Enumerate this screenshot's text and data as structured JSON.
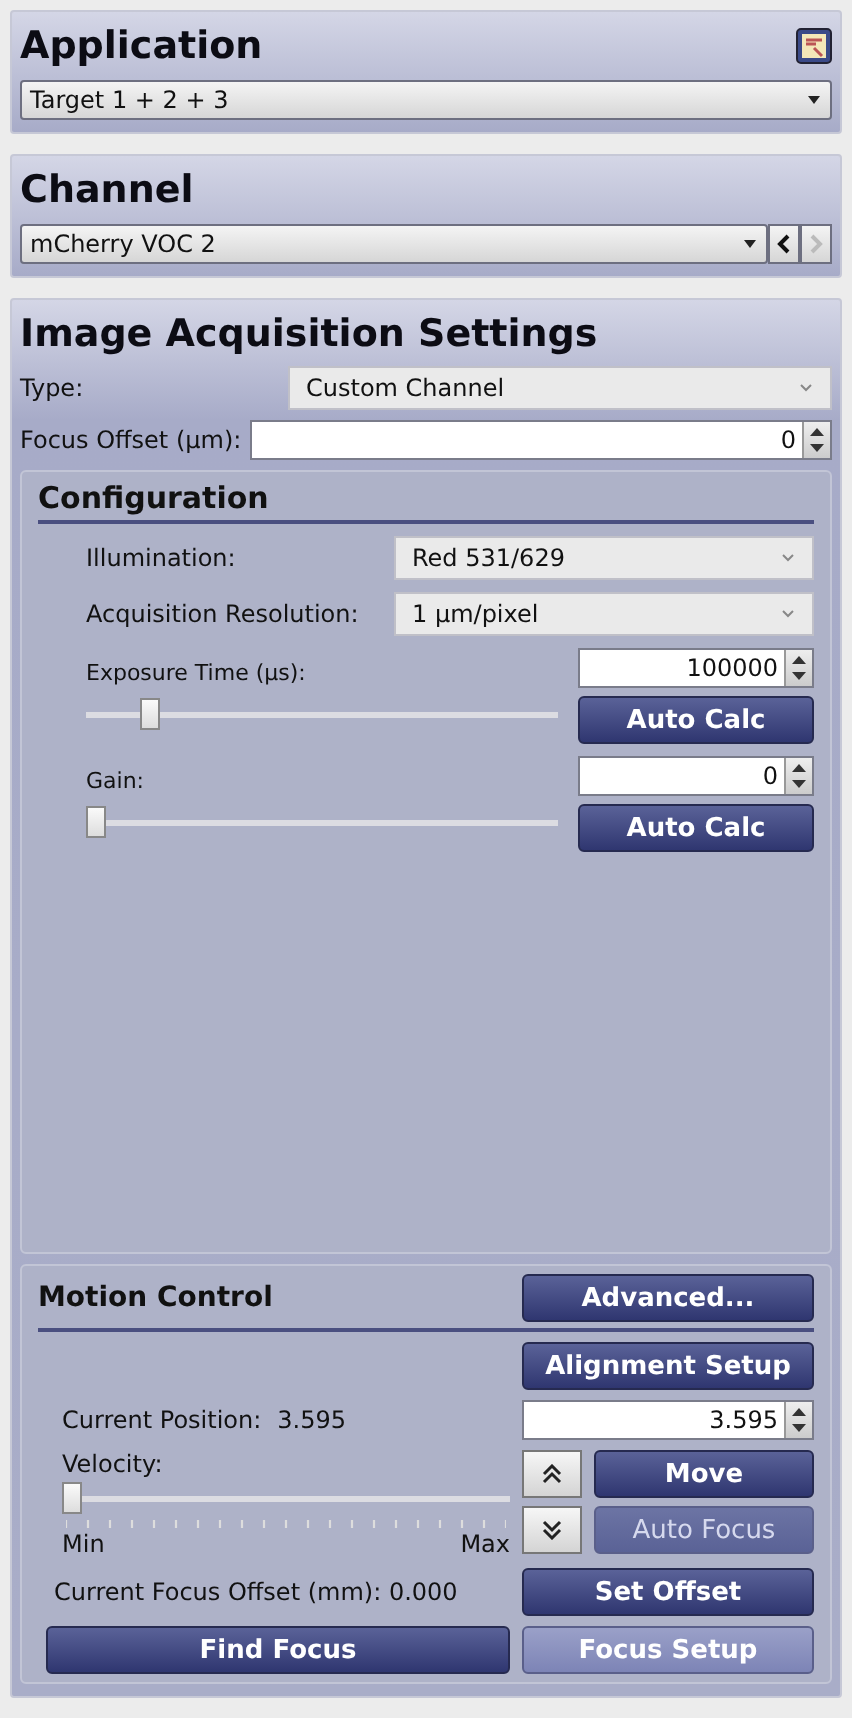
{
  "application": {
    "title": "Application",
    "selected_target": "Target 1 + 2 + 3"
  },
  "channel": {
    "title": "Channel",
    "selected_channel": "mCherry VOC 2",
    "prev_disabled": false,
    "next_disabled": true
  },
  "image_acquisition": {
    "title": "Image Acquisition Settings",
    "type": {
      "label": "Type:",
      "value": "Custom Channel"
    },
    "focus_offset": {
      "label": "Focus Offset (µm):",
      "value": "0"
    },
    "configuration": {
      "title": "Configuration",
      "illumination": {
        "label": "Illumination:",
        "value": "Red 531/629"
      },
      "resolution": {
        "label": "Acquisition Resolution:",
        "value": "1 µm/pixel"
      },
      "exposure": {
        "label": "Exposure Time (µs):",
        "value": "100000",
        "level": 0.12,
        "button": "Auto Calc"
      },
      "gain": {
        "label": "Gain:",
        "value": "0",
        "level": 0,
        "button": "Auto Calc"
      }
    },
    "motion_control": {
      "title": "Motion Control",
      "advanced_button": "Advanced...",
      "alignment_button": "Alignment Setup",
      "position_label": "Current Position:",
      "position_value": "3.595",
      "position_input": "3.595",
      "velocity": {
        "label": "Velocity:",
        "level": 0,
        "min_label": "Min",
        "max_label": "Max"
      },
      "move_button": "Move",
      "auto_focus": {
        "label": "Auto Focus",
        "disabled": true
      },
      "focus_offset_label": "Current Focus Offset (mm): 0.000",
      "set_offset_button": "Set Offset",
      "find_focus_button": "Find Focus",
      "focus_setup": {
        "label": "Focus Setup",
        "disabled": false,
        "kind": "light"
      }
    }
  }
}
